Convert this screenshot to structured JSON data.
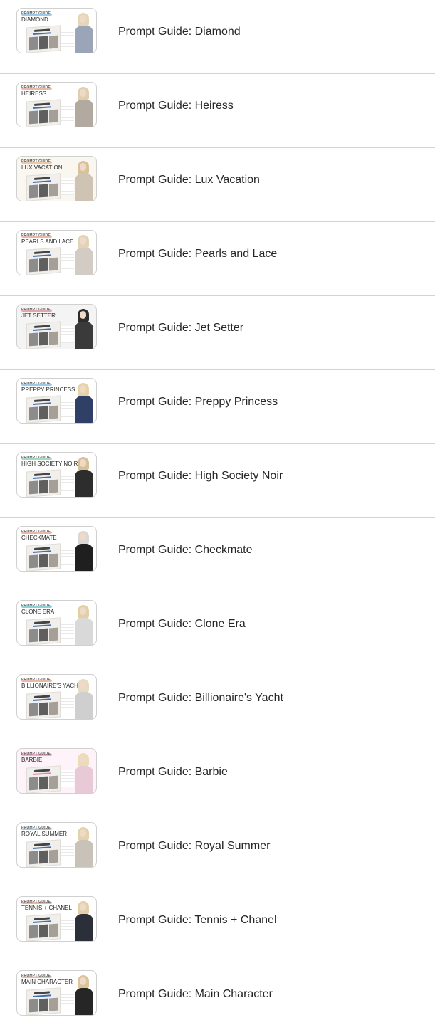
{
  "items": [
    {
      "label": "Prompt Guide: Diamond",
      "tag": "PROMPT GUIDE",
      "thumb_title": "DIAMOND",
      "tag_color": "#9ec9e8",
      "band_color": "#3d6fb5",
      "body_color": "#9aa6b7",
      "hair_color": "#e5d6b8",
      "bg_color": "#ffffff"
    },
    {
      "label": "Prompt Guide: Heiress",
      "tag": "PROMPT GUIDE",
      "thumb_title": "HEIRESS",
      "tag_color": "#e8b9a8",
      "band_color": "#3d6fb5",
      "body_color": "#b2aaa0",
      "hair_color": "#e0cfae",
      "bg_color": "#ffffff"
    },
    {
      "label": "Prompt Guide: Lux Vacation",
      "tag": "PROMPT GUIDE",
      "thumb_title": "LUX VACATION",
      "tag_color": "#e8c9a8",
      "band_color": "#3d6fb5",
      "body_color": "#cfc3b3",
      "hair_color": "#d9c29a",
      "bg_color": "#faf6f0"
    },
    {
      "label": "Prompt Guide: Pearls and Lace",
      "tag": "PROMPT GUIDE",
      "thumb_title": "PEARLS AND LACE",
      "tag_color": "#e8b9a8",
      "band_color": "#3d6fb5",
      "body_color": "#d3ccc4",
      "hair_color": "#e2d3b6",
      "bg_color": "#ffffff"
    },
    {
      "label": "Prompt Guide: Jet Setter",
      "tag": "PROMPT GUIDE",
      "thumb_title": "JET SETTER",
      "tag_color": "#e0a8a8",
      "band_color": "#3d6fb5",
      "body_color": "#3a3a3a",
      "hair_color": "#2c2c2c",
      "bg_color": "#f4f4f4"
    },
    {
      "label": "Prompt Guide: Preppy Princess",
      "tag": "PROMPT GUIDE",
      "thumb_title": "PREPPY PRINCESS",
      "tag_color": "#9ec9e8",
      "band_color": "#3d6fb5",
      "body_color": "#2f3f66",
      "hair_color": "#e6d3a8",
      "bg_color": "#ffffff"
    },
    {
      "label": "Prompt Guide: High Society Noir",
      "tag": "PROMPT GUIDE",
      "thumb_title": "HIGH SOCIETY NOIR",
      "tag_color": "#a8d8c0",
      "band_color": "#3d6fb5",
      "body_color": "#2d2d2d",
      "hair_color": "#d6c098",
      "bg_color": "#ffffff"
    },
    {
      "label": "Prompt Guide: Checkmate",
      "tag": "PROMPT GUIDE",
      "thumb_title": "CHECKMATE",
      "tag_color": "#e8b9a8",
      "band_color": "#3d6fb5",
      "body_color": "#1f1f1f",
      "hair_color": "#d8d8d8",
      "bg_color": "#ffffff"
    },
    {
      "label": "Prompt Guide: Clone Era",
      "tag": "PROMPT GUIDE",
      "thumb_title": "CLONE ERA",
      "tag_color": "#8fd0d6",
      "band_color": "#3d6fb5",
      "body_color": "#d9d9d9",
      "hair_color": "#e3cfa6",
      "bg_color": "#ffffff"
    },
    {
      "label": "Prompt Guide: Billionaire's Yacht",
      "tag": "PROMPT GUIDE",
      "thumb_title": "BILLIONAIRE'S YACHT",
      "tag_color": "#e8b9a8",
      "band_color": "#3d6fb5",
      "body_color": "#cfcfcf",
      "hair_color": "#e6dcc2",
      "bg_color": "#ffffff"
    },
    {
      "label": "Prompt Guide: Barbie",
      "tag": "PROMPT GUIDE",
      "thumb_title": "BARBIE",
      "tag_color": "#f3a8cc",
      "band_color": "#e77fb3",
      "body_color": "#e8c9d6",
      "hair_color": "#ecdcb4",
      "bg_color": "#fdf3f8"
    },
    {
      "label": "Prompt Guide: Royal Summer",
      "tag": "PROMPT GUIDE",
      "thumb_title": "ROYAL SUMMER",
      "tag_color": "#9ec9e8",
      "band_color": "#3d6fb5",
      "body_color": "#c8c2b8",
      "hair_color": "#e4d2ac",
      "bg_color": "#ffffff"
    },
    {
      "label": "Prompt Guide: Tennis + Chanel",
      "tag": "PROMPT GUIDE",
      "thumb_title": "TENNIS + CHANEL",
      "tag_color": "#e8b9a8",
      "band_color": "#3d6fb5",
      "body_color": "#2b2f3a",
      "hair_color": "#e3d0a8",
      "bg_color": "#ffffff"
    },
    {
      "label": "Prompt Guide: Main Character",
      "tag": "PROMPT GUIDE",
      "thumb_title": "MAIN CHARACTER",
      "tag_color": "#e8b9a8",
      "band_color": "#3d6fb5",
      "body_color": "#262626",
      "hair_color": "#dcc49a",
      "bg_color": "#ffffff"
    }
  ]
}
